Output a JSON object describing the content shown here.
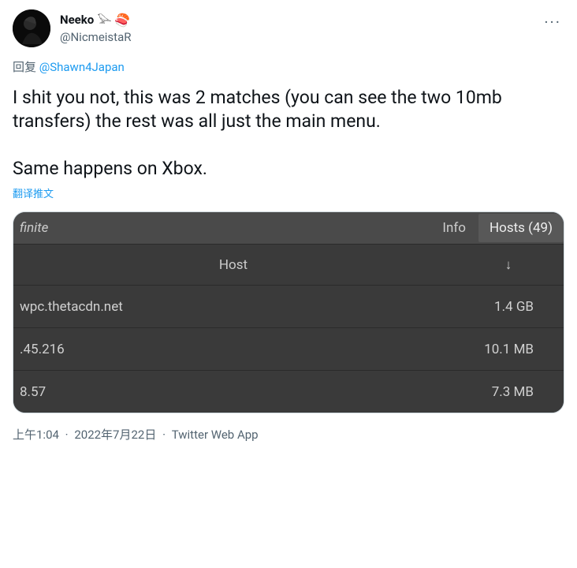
{
  "user": {
    "display_name": "Neeko",
    "username": "@NicmeistaR",
    "bird_emoji": "𓅪",
    "sushi_emoji": "🍣"
  },
  "reply": {
    "label": "回复",
    "mention": "@Shawn4Japan"
  },
  "tweet_text": "I shit you not, this was 2 matches (you can see the two 10mb transfers) the rest was all just the main menu.\n\nSame happens on Xbox.",
  "translate_label": "翻译推文",
  "embedded_table": {
    "title_fragment": "finite",
    "info_label": "Info",
    "hosts_label": "Hosts (49)",
    "col_host": "Host",
    "col_sort": "↓",
    "rows": [
      {
        "host": "wpc.thetacdn.net",
        "size": "1.4 GB"
      },
      {
        "host": ".45.216",
        "size": "10.1 MB"
      },
      {
        "host": "8.57",
        "size": "7.3 MB"
      }
    ]
  },
  "meta": {
    "time": "上午1:04",
    "date": "2022年7月22日",
    "source": "Twitter Web App"
  }
}
